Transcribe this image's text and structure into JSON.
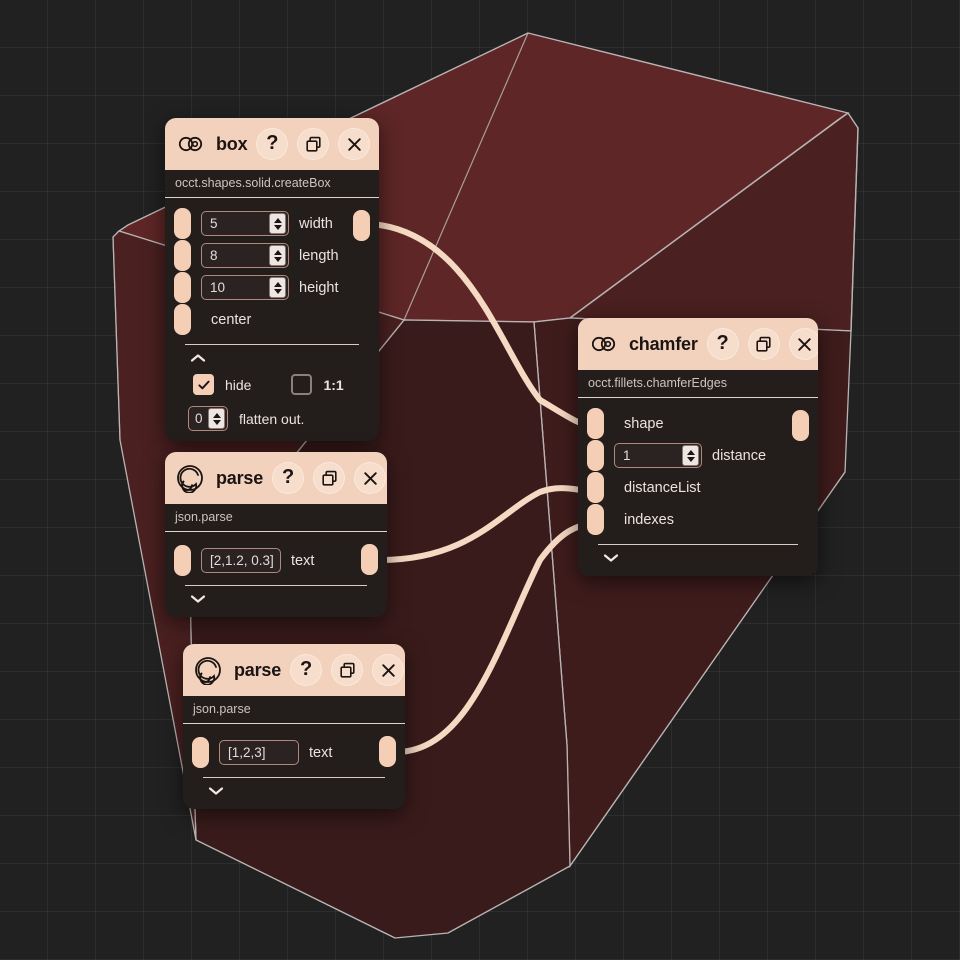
{
  "canvas": {
    "background_color": "#212121",
    "grid_color": "#353535",
    "grid_size": 48
  },
  "viewport": {
    "solid_name": "chamfered-box-solid",
    "fill_color": "#5e2626",
    "fill_color_dark": "#3a1d1d",
    "edge_color": "#b9b3b3"
  },
  "wire": {
    "color": "#f6d9c2",
    "connections": [
      {
        "from": "box.output",
        "to": "chamfer.shape"
      },
      {
        "from": "parse1.output",
        "to": "chamfer.distanceList"
      },
      {
        "from": "parse2.output",
        "to": "chamfer.indexes"
      }
    ]
  },
  "nodes": {
    "box": {
      "title": "box",
      "logo_icon": "bitbybit-link-icon",
      "subtitle": "occt.shapes.solid.createBox",
      "header_buttons": [
        {
          "name": "help-button",
          "label": "?"
        },
        {
          "name": "copy-button",
          "label": "copy-icon"
        },
        {
          "name": "close-button",
          "label": "close-icon"
        }
      ],
      "inputs": [
        {
          "label": "width",
          "value": "5",
          "type": "number"
        },
        {
          "label": "length",
          "value": "8",
          "type": "number"
        },
        {
          "label": "height",
          "value": "10",
          "type": "number"
        },
        {
          "label": "center",
          "value": "",
          "type": "socket"
        }
      ],
      "output_socket": "box-output",
      "collapse_icon": "chevron-up-icon",
      "options": {
        "hide": {
          "label": "hide",
          "checked": true
        },
        "ratio": {
          "label": "1:1",
          "checked": false
        },
        "flatten": {
          "label": "flatten out.",
          "value": "0"
        }
      }
    },
    "chamfer": {
      "title": "chamfer",
      "logo_icon": "bitbybit-link-icon",
      "subtitle": "occt.fillets.chamferEdges",
      "header_buttons": [
        {
          "name": "help-button",
          "label": "?"
        },
        {
          "name": "copy-button",
          "label": "copy-icon"
        },
        {
          "name": "close-button",
          "label": "close-icon"
        }
      ],
      "inputs": [
        {
          "label": "shape",
          "value": "",
          "type": "socket"
        },
        {
          "label": "distance",
          "value": "1",
          "type": "number"
        },
        {
          "label": "distanceList",
          "value": "",
          "type": "socket"
        },
        {
          "label": "indexes",
          "value": "",
          "type": "socket"
        }
      ],
      "output_socket": "chamfer-output",
      "collapse_icon": "chevron-down-icon"
    },
    "parse1": {
      "title": "parse",
      "logo_icon": "json-spiral-icon",
      "subtitle": "json.parse",
      "header_buttons": [
        {
          "name": "help-button",
          "label": "?"
        },
        {
          "name": "copy-button",
          "label": "copy-icon"
        },
        {
          "name": "close-button",
          "label": "close-icon"
        }
      ],
      "inputs": [
        {
          "label": "text",
          "value": "[2,1.2, 0.3]",
          "type": "text"
        }
      ],
      "output_socket": "parse1-output",
      "collapse_icon": "chevron-down-icon"
    },
    "parse2": {
      "title": "parse",
      "logo_icon": "json-spiral-icon",
      "subtitle": "json.parse",
      "header_buttons": [
        {
          "name": "help-button",
          "label": "?"
        },
        {
          "name": "copy-button",
          "label": "copy-icon"
        },
        {
          "name": "close-button",
          "label": "close-icon"
        }
      ],
      "inputs": [
        {
          "label": "text",
          "value": "[1,2,3]",
          "type": "text"
        }
      ],
      "output_socket": "parse2-output",
      "collapse_icon": "chevron-down-icon"
    }
  }
}
